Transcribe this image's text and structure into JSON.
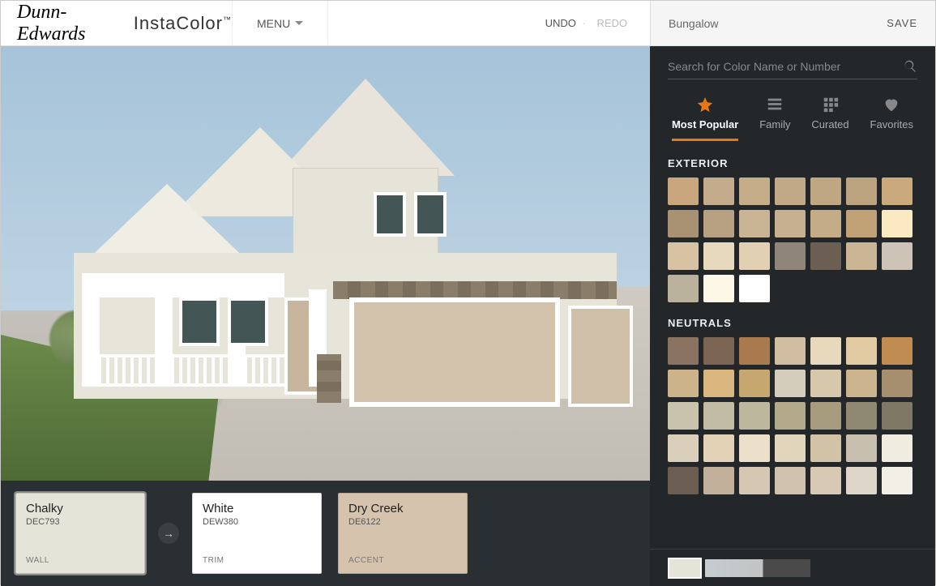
{
  "brand": {
    "script": "Dunn-Edwards",
    "insta": "InstaColor",
    "tm": "™"
  },
  "menu_label": "MENU",
  "undo_label": "UNDO",
  "redo_label": "REDO",
  "project_name": "Bungalow",
  "save_label": "SAVE",
  "search_placeholder": "Search for Color Name or Number",
  "tabs": {
    "popular": "Most Popular",
    "family": "Family",
    "curated": "Curated",
    "favorites": "Favorites"
  },
  "selected": [
    {
      "name": "Chalky",
      "code": "DEC793",
      "slot": "WALL",
      "bg": "#e5e4d9"
    },
    {
      "name": "White",
      "code": "DEW380",
      "slot": "TRIM",
      "bg": "#ffffff"
    },
    {
      "name": "Dry Creek",
      "code": "DE6122",
      "slot": "ACCENT",
      "bg": "#d6c3ae"
    }
  ],
  "groups": [
    {
      "title": "EXTERIOR",
      "colors": [
        "#c9a67d",
        "#c3ab8b",
        "#c6ad8a",
        "#c1a887",
        "#bfa783",
        "#bda481",
        "#caa97c",
        "#a89273",
        "#b7a182",
        "#c9b594",
        "#c6b08f",
        "#c4ac86",
        "#c0a276",
        "#fbe9c1",
        "#d7c3a3",
        "#e6d9be",
        "#e2d0b3",
        "#8f857a",
        "#6b5f54",
        "#cab595",
        "#cdc3b6",
        "#bab29c",
        "#fdf7e7",
        "#ffffff"
      ]
    },
    {
      "title": "NEUTRALS",
      "colors": [
        "#8a7360",
        "#7b6552",
        "#a87a4e",
        "#d1bda2",
        "#e8d9bd",
        "#e2cba3",
        "#c08c51",
        "#cdb38a",
        "#d9b77f",
        "#c6a76f",
        "#d4cdbc",
        "#d8c8ab",
        "#ccb58e",
        "#a68f6f",
        "#c9c2ac",
        "#c3bca4",
        "#bdb79e",
        "#b2a98b",
        "#a79c7e",
        "#8f8971",
        "#7e7865",
        "#d9cfba",
        "#e3d2b5",
        "#ece0ca",
        "#e1d5bc",
        "#d2c3a7",
        "#c9bfae",
        "#f1ece0",
        "#6b5d52",
        "#c3b09a",
        "#d6c7b3",
        "#cfc1ab",
        "#d7c9b3",
        "#ddd6c9",
        "#f1efe6"
      ]
    }
  ],
  "mini_swatch": "#e5e4d9"
}
